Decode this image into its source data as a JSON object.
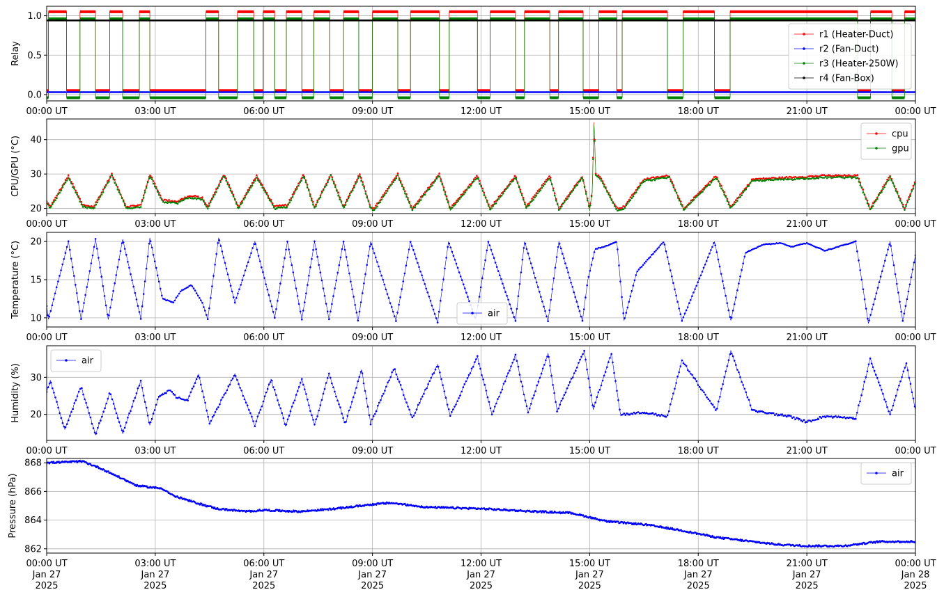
{
  "chart_data": [
    {
      "type": "line",
      "id": "relay",
      "ylabel": "Relay",
      "ylim": [
        -0.08,
        1.12
      ],
      "yticks": [
        0.0,
        0.5,
        1.0
      ],
      "ytick_labels": [
        "0.0",
        "0.5",
        "1.0"
      ],
      "grid": true,
      "legend_position": "right",
      "x_tick_labels": [
        "00:00 UT",
        "03:00 UT",
        "06:00 UT",
        "09:00 UT",
        "12:00 UT",
        "15:00 UT",
        "18:00 UT",
        "21:00 UT",
        "00:00 UT"
      ],
      "on_intervals_hours": [
        [
          0.05,
          0.55
        ],
        [
          0.92,
          1.35
        ],
        [
          1.74,
          2.1
        ],
        [
          2.56,
          2.85
        ],
        [
          4.4,
          4.75
        ],
        [
          5.27,
          5.72
        ],
        [
          5.98,
          6.3
        ],
        [
          6.62,
          7.05
        ],
        [
          7.38,
          7.82
        ],
        [
          8.2,
          8.62
        ],
        [
          9.0,
          9.7
        ],
        [
          10.05,
          10.85
        ],
        [
          11.12,
          11.9
        ],
        [
          12.25,
          12.95
        ],
        [
          13.2,
          13.9
        ],
        [
          14.14,
          14.82
        ],
        [
          15.25,
          15.75
        ],
        [
          15.9,
          17.15
        ],
        [
          17.58,
          18.45
        ],
        [
          18.88,
          22.4
        ],
        [
          22.76,
          23.35
        ],
        [
          23.7,
          24.0
        ]
      ],
      "series": [
        {
          "name": "r1 (Heater-Duct)",
          "color": "#ff0000",
          "on_value": 1.05,
          "off_value": 0.05
        },
        {
          "name": "r2 (Fan-Duct)",
          "color": "#0000ff",
          "constant": 0.03
        },
        {
          "name": "r3 (Heater-250W)",
          "color": "#008000",
          "on_value": 0.96,
          "off_value": -0.04
        },
        {
          "name": "r4 (Fan-Box)",
          "color": "#000000",
          "constant": 0.94
        }
      ]
    },
    {
      "type": "line",
      "id": "cpu_gpu",
      "ylabel": "CPU/GPU (°C)",
      "ylim": [
        18.5,
        46
      ],
      "yticks": [
        20,
        30,
        40
      ],
      "ytick_labels": [
        "20",
        "30",
        "40"
      ],
      "grid": true,
      "legend_position": "top-right",
      "x_tick_labels": [
        "00:00 UT",
        "03:00 UT",
        "06:00 UT",
        "09:00 UT",
        "12:00 UT",
        "15:00 UT",
        "18:00 UT",
        "21:00 UT",
        "00:00 UT"
      ],
      "series": [
        {
          "name": "cpu",
          "color": "#ff0000",
          "x_hours": [
            0,
            0.1,
            0.6,
            1.0,
            1.3,
            1.8,
            2.2,
            2.6,
            2.85,
            3.2,
            3.6,
            3.9,
            4.1,
            4.3,
            4.45,
            4.9,
            5.3,
            5.8,
            6.3,
            6.65,
            7.1,
            7.4,
            7.85,
            8.2,
            8.65,
            8.95,
            9.05,
            9.7,
            10.1,
            10.85,
            11.15,
            11.9,
            12.25,
            12.95,
            13.25,
            13.9,
            14.15,
            14.8,
            15.0,
            15.07,
            15.12,
            15.17,
            15.3,
            15.75,
            15.95,
            16.5,
            17.2,
            17.6,
            18.5,
            18.9,
            19.5,
            20.5,
            21.5,
            22.4,
            22.75,
            23.3,
            23.7,
            24.0
          ],
          "values": [
            22,
            20.5,
            29.5,
            21,
            20.5,
            30,
            20.5,
            21,
            30,
            22.5,
            22,
            23.5,
            23.5,
            23,
            20.5,
            30,
            20.5,
            29.5,
            20.5,
            21,
            30,
            20.5,
            30,
            20.5,
            30,
            20.5,
            20,
            30,
            20,
            30,
            20,
            29.5,
            20,
            29.5,
            20.5,
            29.5,
            20,
            29.5,
            20,
            25,
            45,
            30,
            29,
            20,
            20.5,
            28.5,
            29.5,
            20,
            29.5,
            20.5,
            28.5,
            29,
            29.5,
            29.5,
            20,
            29.5,
            20,
            28
          ]
        },
        {
          "name": "gpu",
          "color": "#008000",
          "x_hours": [
            0,
            0.1,
            0.6,
            1.0,
            1.3,
            1.8,
            2.2,
            2.6,
            2.85,
            3.2,
            3.6,
            3.9,
            4.1,
            4.3,
            4.45,
            4.9,
            5.3,
            5.8,
            6.3,
            6.65,
            7.1,
            7.4,
            7.85,
            8.2,
            8.65,
            8.95,
            9.05,
            9.7,
            10.1,
            10.85,
            11.15,
            11.9,
            12.25,
            12.95,
            13.25,
            13.9,
            14.15,
            14.8,
            15.0,
            15.07,
            15.12,
            15.17,
            15.3,
            15.75,
            15.95,
            16.5,
            17.2,
            17.6,
            18.5,
            18.9,
            19.5,
            20.5,
            21.5,
            22.4,
            22.75,
            23.3,
            23.7,
            24.0
          ],
          "values": [
            21.5,
            20,
            29,
            20.5,
            20,
            29.5,
            20,
            20.5,
            29.5,
            22,
            21.5,
            23,
            23,
            22.5,
            20,
            29.5,
            20,
            29,
            20,
            20.5,
            29.5,
            20,
            29.5,
            20,
            29.5,
            20,
            19.5,
            29.5,
            19.5,
            29.5,
            19.5,
            29,
            19.5,
            29,
            20,
            29,
            19.5,
            29,
            19.5,
            24.5,
            44.5,
            29.5,
            28.5,
            19.5,
            20,
            28,
            29,
            19.5,
            29,
            20,
            28,
            28.5,
            29,
            29,
            19.5,
            29,
            19.5,
            27.5
          ]
        }
      ]
    },
    {
      "type": "line",
      "id": "temperature",
      "ylabel": "Temperature (°C)",
      "ylim": [
        8.8,
        21.2
      ],
      "yticks": [
        10,
        15,
        20
      ],
      "ytick_labels": [
        "10",
        "15",
        "20"
      ],
      "grid": true,
      "legend_position": "bottom-center",
      "x_tick_labels": [
        "00:00 UT",
        "03:00 UT",
        "06:00 UT",
        "09:00 UT",
        "12:00 UT",
        "15:00 UT",
        "18:00 UT",
        "21:00 UT",
        "00:00 UT"
      ],
      "series": [
        {
          "name": "air",
          "color": "#0000ff",
          "x_hours": [
            0,
            0.05,
            0.6,
            0.95,
            1.35,
            1.7,
            2.1,
            2.6,
            2.85,
            3.2,
            3.5,
            3.7,
            4.0,
            4.3,
            4.45,
            4.75,
            5.2,
            5.75,
            6.3,
            6.65,
            7.05,
            7.4,
            7.8,
            8.2,
            8.6,
            8.95,
            9.65,
            10.05,
            10.8,
            11.1,
            11.85,
            12.2,
            12.95,
            13.2,
            13.85,
            14.15,
            14.8,
            14.95,
            15.15,
            15.5,
            15.75,
            15.95,
            16.3,
            17.05,
            17.55,
            18.45,
            18.9,
            19.3,
            19.8,
            20.3,
            20.6,
            21.0,
            21.5,
            22.35,
            22.7,
            23.3,
            23.65,
            24.0
          ],
          "values": [
            11.5,
            9.8,
            20,
            9.8,
            20.3,
            9.8,
            20.3,
            9.9,
            20.5,
            12.5,
            12,
            13.5,
            14.3,
            12,
            9.8,
            20.5,
            12,
            20,
            10,
            20,
            9.8,
            20,
            9.8,
            20,
            9.6,
            20,
            9.6,
            20,
            9.4,
            20,
            9.8,
            20,
            9.6,
            20,
            9.6,
            20,
            9.6,
            15,
            19,
            19.5,
            20,
            9.6,
            16,
            20,
            9.6,
            20,
            9.6,
            18.5,
            19.6,
            19.8,
            19.3,
            19.8,
            18.8,
            20,
            9.3,
            20,
            9.6,
            18.2
          ]
        }
      ]
    },
    {
      "type": "line",
      "id": "humidity",
      "ylabel": "Humidity (%)",
      "ylim": [
        13,
        38.5
      ],
      "yticks": [
        20,
        30
      ],
      "ytick_labels": [
        "20",
        "30"
      ],
      "grid": true,
      "legend_position": "top-left",
      "x_tick_labels": [
        "00:00 UT",
        "03:00 UT",
        "06:00 UT",
        "09:00 UT",
        "12:00 UT",
        "15:00 UT",
        "18:00 UT",
        "21:00 UT",
        "00:00 UT"
      ],
      "series": [
        {
          "name": "air",
          "color": "#0000ff",
          "x_hours": [
            0,
            0.1,
            0.5,
            0.95,
            1.35,
            1.75,
            2.1,
            2.6,
            2.85,
            3.1,
            3.4,
            3.6,
            3.9,
            4.2,
            4.5,
            5.2,
            5.75,
            6.2,
            6.6,
            7.05,
            7.4,
            7.8,
            8.25,
            8.7,
            8.95,
            9.6,
            10.1,
            10.8,
            11.15,
            11.9,
            12.3,
            12.95,
            13.3,
            13.85,
            14.1,
            14.85,
            15.1,
            15.6,
            15.85,
            16.5,
            17.15,
            17.55,
            18.5,
            18.9,
            19.5,
            20.5,
            21.0,
            21.5,
            22.35,
            22.75,
            23.3,
            23.75,
            24.0
          ],
          "values": [
            26,
            29,
            16,
            27.5,
            14.5,
            26,
            15,
            29,
            17,
            25,
            26.5,
            24.5,
            24,
            31,
            17.5,
            31,
            17,
            29.5,
            17,
            29.5,
            17,
            31,
            17.5,
            32,
            17.5,
            32.5,
            19,
            33.5,
            19.5,
            35.5,
            20,
            36,
            20.5,
            36.5,
            21,
            37,
            21.5,
            36.5,
            20,
            20.5,
            19.5,
            34.5,
            21,
            37,
            21,
            19.5,
            18,
            19.5,
            19,
            35,
            20,
            34,
            21
          ]
        }
      ]
    },
    {
      "type": "line",
      "id": "pressure",
      "ylabel": "Pressure (hPa)",
      "ylim": [
        861.7,
        868.3
      ],
      "yticks": [
        862,
        864,
        866,
        868
      ],
      "ytick_labels": [
        "862",
        "864",
        "866",
        "868"
      ],
      "grid": true,
      "legend_position": "top-right",
      "x_tick_labels": [
        "00:00 UT\nJan 27\n2025",
        "03:00 UT\nJan 27\n2025",
        "06:00 UT\nJan 27\n2025",
        "09:00 UT\nJan 27\n2025",
        "12:00 UT\nJan 27\n2025",
        "15:00 UT\nJan 27\n2025",
        "18:00 UT\nJan 27\n2025",
        "21:00 UT\nJan 27\n2025",
        "00:00 UT\nJan 28\n2025"
      ],
      "series": [
        {
          "name": "air",
          "color": "#0000ff",
          "x_hours": [
            0,
            1.0,
            1.5,
            2.5,
            3.2,
            3.5,
            4.0,
            4.7,
            5.5,
            6.0,
            7.0,
            8.0,
            9.0,
            9.5,
            10.5,
            12.0,
            13.5,
            14.5,
            15.5,
            16.5,
            17.5,
            18.5,
            19.5,
            20.2,
            21.0,
            22.0,
            23.0,
            24.0
          ],
          "values": [
            868,
            868.1,
            867.6,
            866.4,
            866.2,
            865.7,
            865.3,
            864.8,
            864.6,
            864.7,
            864.6,
            864.8,
            865.1,
            865.2,
            864.9,
            864.8,
            864.6,
            864.5,
            863.9,
            863.7,
            863.3,
            862.8,
            862.5,
            862.3,
            862.2,
            862.2,
            862.5,
            862.5
          ]
        }
      ]
    }
  ]
}
